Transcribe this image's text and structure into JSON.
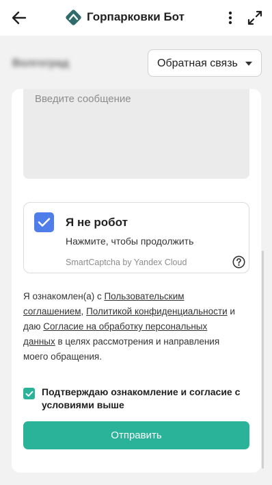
{
  "header": {
    "title": "Горпарковки Бот",
    "icons": {
      "back": "arrow-left-icon",
      "logo": "gorparkovki-logo-icon",
      "menu": "more-vertical-icon",
      "expand": "expand-icon"
    }
  },
  "form": {
    "city": "Волгоград",
    "topic_selected": "Обратная связь",
    "message_placeholder": "Введите сообщение",
    "captcha": {
      "title": "Я не робот",
      "subtitle": "Нажмите, чтобы продолжить",
      "brand": "SmartCaptcha by Yandex Cloud",
      "checked": true
    },
    "consent": {
      "part1": "Я ознакомлен(а) с ",
      "link_user_agreement": "Пользовательским соглашением",
      "comma": ", ",
      "link_privacy": "Политикой конфиденциальности",
      "part2": " и даю ",
      "link_consent": "Согласие на обработку персональных данных",
      "part3": " в целях рассмотрения и направления моего обращения."
    },
    "confirm_label": "Подтверждаю ознакомление и согласие с условиями выше",
    "confirm_checked": true,
    "submit_label": "Отправить"
  },
  "colors": {
    "accent": "#2bb39a",
    "captcha_blue": "#4f7de9",
    "logo": "#2f6b6b"
  }
}
